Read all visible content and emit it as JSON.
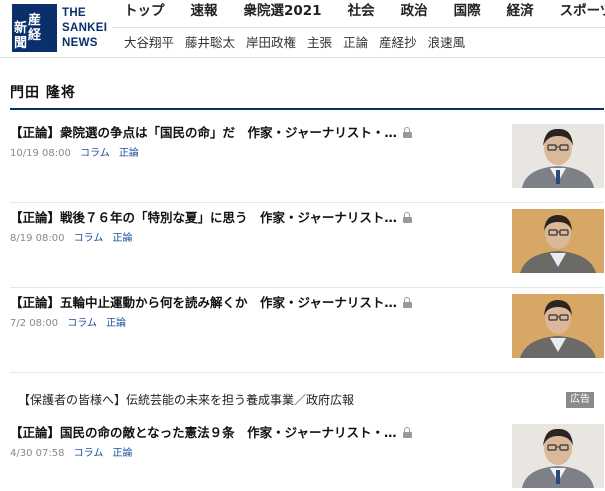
{
  "logo": {
    "kanji": [
      "産",
      "経",
      "新",
      "聞"
    ],
    "text_lines": [
      "THE",
      "SANKEI",
      "NEWS"
    ],
    "color": "#0a2f6b"
  },
  "nav_primary": [
    "トップ",
    "速報",
    "衆院選2021",
    "社会",
    "政治",
    "国際",
    "経済",
    "スポーツ"
  ],
  "nav_secondary": [
    "大谷翔平",
    "藤井聡太",
    "岸田政権",
    "主張",
    "正論",
    "産経抄",
    "浪速風"
  ],
  "page_title": "門田 隆将",
  "articles": [
    {
      "headline": "【正論】衆院選の争点は「国民の命」だ　作家・ジャーナリスト・…",
      "date": "10/19 08:00",
      "tags": [
        "コラム",
        "正論"
      ],
      "thumb": "author-portrait",
      "locked": true
    },
    {
      "headline": "【正論】戦後７６年の「特別な夏」に思う　作家・ジャーナリスト…",
      "date": "8/19 08:00",
      "tags": [
        "コラム",
        "正論"
      ],
      "thumb": "author-portrait",
      "locked": true
    },
    {
      "headline": "【正論】五輪中止運動から何を読み解くか　作家・ジャーナリスト…",
      "date": "7/2 08:00",
      "tags": [
        "コラム",
        "正論"
      ],
      "thumb": "author-portrait",
      "locked": true
    },
    {
      "headline": "【正論】国民の命の敵となった憲法９条　作家・ジャーナリスト・…",
      "date": "4/30 07:58",
      "tags": [
        "コラム",
        "正論"
      ],
      "thumb": "author-portrait",
      "locked": true
    }
  ],
  "ad": {
    "text": "【保護者の皆様へ】伝統芸能の未来を担う養成事業／政府広報",
    "badge": "広告"
  },
  "colors": {
    "brand": "#0a2f6b",
    "tag_link": "#1a4fa0",
    "date": "#888888"
  }
}
